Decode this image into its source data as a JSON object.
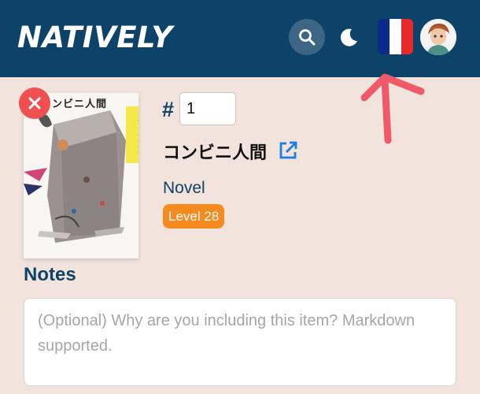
{
  "app": {
    "logo_text": "NATIVELY"
  },
  "header": {
    "search_icon": "search-icon",
    "theme_icon": "moon-icon",
    "language_flag": "france-flag",
    "flag_colors": [
      "#0a2b8c",
      "#ffffff",
      "#e8282b"
    ],
    "avatar_icon": "user-avatar"
  },
  "item": {
    "cover": {
      "title_text": "コンビニ人間",
      "author_text": "村田沙耶香"
    },
    "number_prefix": "#",
    "number_value": "1",
    "title": "コンビニ人間",
    "type": "Novel",
    "level": "Level 28"
  },
  "notes": {
    "label": "Notes",
    "placeholder": "(Optional) Why are you including this item? Markdown supported.",
    "value": ""
  },
  "colors": {
    "header_bg": "#0d4368",
    "page_bg": "#f2e3dd",
    "accent_orange": "#f58a1f",
    "remove_red": "#ef5151",
    "link_blue": "#1b7fe0"
  }
}
